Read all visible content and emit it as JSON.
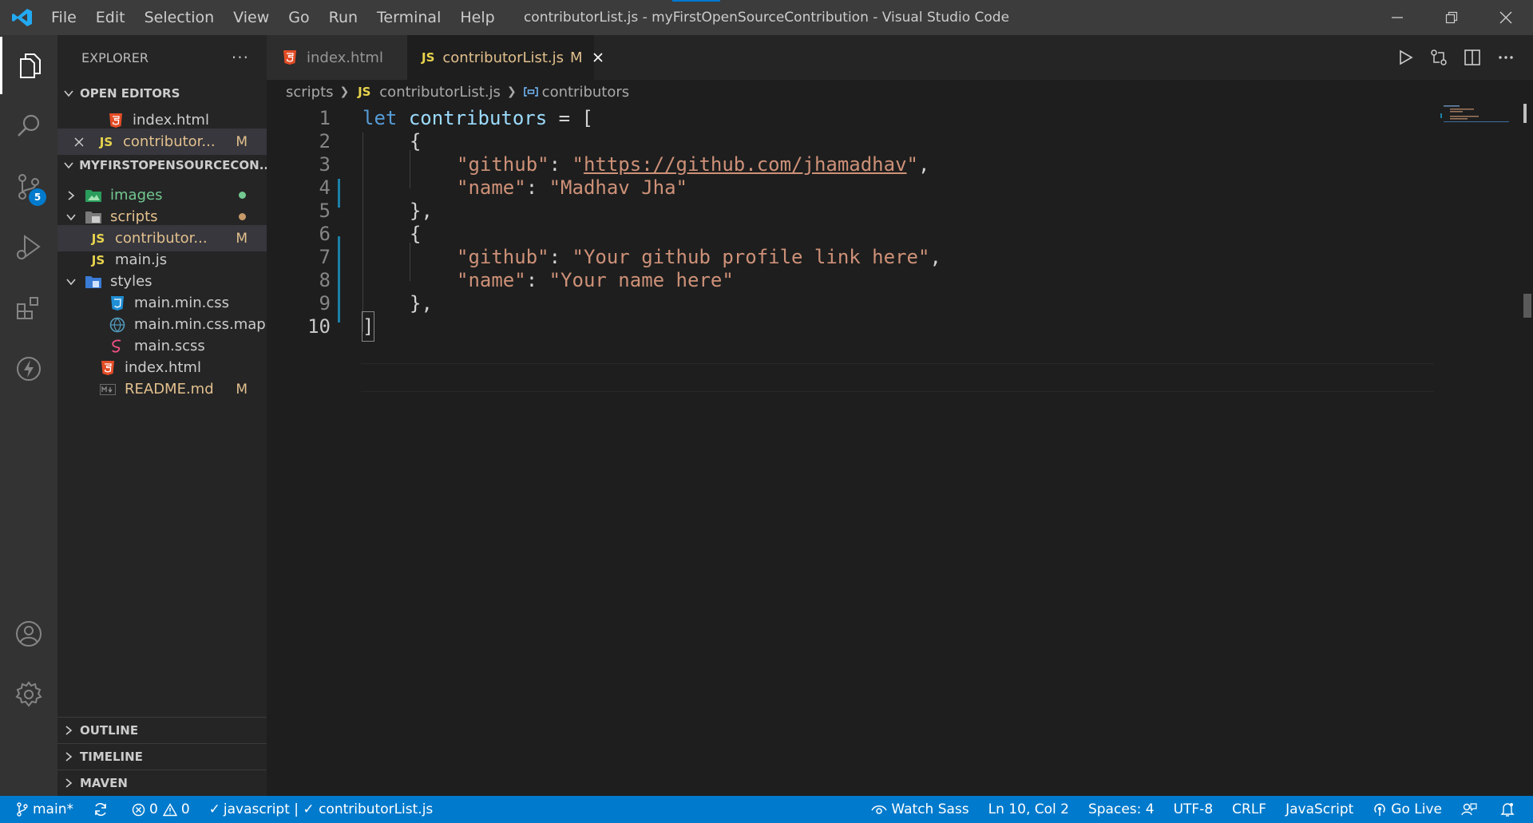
{
  "window": {
    "title": "contributorList.js - myFirstOpenSourceContribution - Visual Studio Code"
  },
  "menu": [
    "File",
    "Edit",
    "Selection",
    "View",
    "Go",
    "Run",
    "Terminal",
    "Help"
  ],
  "activity": {
    "source_control_badge": "5"
  },
  "sidebar": {
    "title": "EXPLORER",
    "more": "···",
    "open_editors_label": "OPEN EDITORS",
    "open_editors": [
      {
        "name": "index.html",
        "flag": ""
      },
      {
        "name": "contributor...",
        "flag": "M"
      }
    ],
    "workspace_label": "MYFIRSTOPENSOURCECON...",
    "tree": [
      {
        "name": "images"
      },
      {
        "name": "scripts"
      },
      {
        "name": "contributor...",
        "flag": "M"
      },
      {
        "name": "main.js"
      },
      {
        "name": "styles"
      },
      {
        "name": "main.min.css"
      },
      {
        "name": "main.min.css.map"
      },
      {
        "name": "main.scss"
      },
      {
        "name": "index.html"
      },
      {
        "name": "README.md",
        "flag": "M"
      }
    ],
    "outline_label": "OUTLINE",
    "timeline_label": "TIMELINE",
    "maven_label": "MAVEN"
  },
  "tabs": [
    {
      "label": "index.html",
      "flag": ""
    },
    {
      "label": "contributorList.js",
      "flag": "M"
    }
  ],
  "breadcrumb": {
    "folder": "scripts",
    "file": "contributorList.js",
    "symbol": "contributors"
  },
  "editor": {
    "line_numbers": [
      "1",
      "2",
      "3",
      "4",
      "5",
      "6",
      "7",
      "8",
      "9",
      "10"
    ],
    "line1": {
      "kw": "let",
      "name": "contributors",
      "rest": " = ["
    },
    "line2": "{",
    "line3": {
      "key": "\"github\"",
      "colon": ": ",
      "q1": "\"",
      "url": "https://github.com/jhamadhav",
      "q2": "\"",
      "tail": ","
    },
    "line4": {
      "key": "\"name\"",
      "colon": ": ",
      "value": "\"Madhav Jha\""
    },
    "line5": "},",
    "line6": "{",
    "line7": {
      "key": "\"github\"",
      "colon": ": ",
      "value": "\"Your github profile link here\"",
      "tail": ","
    },
    "line8": {
      "key": "\"name\"",
      "colon": ": ",
      "value": "\"Your name here\""
    },
    "line9": "},",
    "line10": "]",
    "current_line": 10
  },
  "statusbar": {
    "branch": "main*",
    "errors": "0",
    "warnings": "0",
    "checks": "javascript | ✓ contributorList.js",
    "watch_sass": "Watch Sass",
    "position": "Ln 10, Col 2",
    "spaces": "Spaces: 4",
    "encoding": "UTF-8",
    "eol": "CRLF",
    "language": "JavaScript",
    "go_live": "Go Live"
  },
  "colors": {
    "status_bar": "#007acc",
    "activity_bar": "#333333",
    "sidebar": "#252526",
    "editor": "#1e1e1e",
    "modified": "#e2c08d",
    "untracked": "#73c991"
  }
}
